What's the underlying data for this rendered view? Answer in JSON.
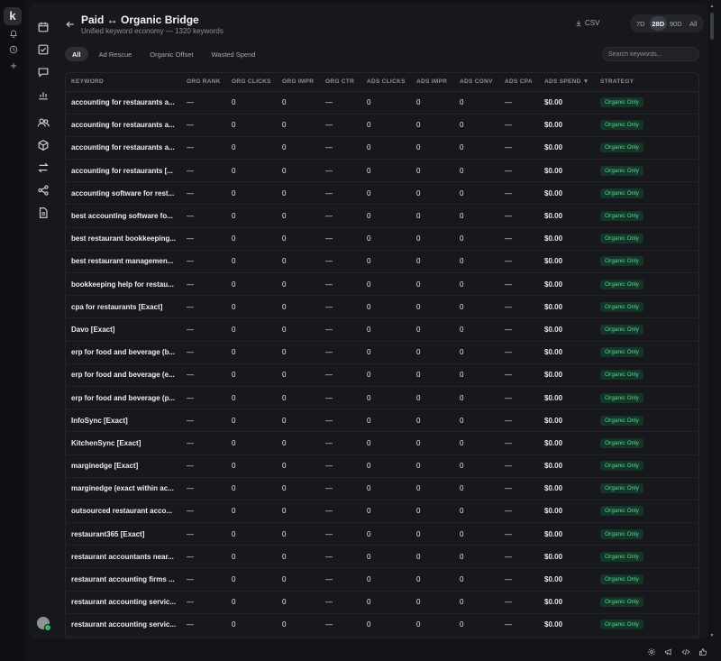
{
  "rail": {
    "logo": "k"
  },
  "header": {
    "title": "Paid ↔ Organic Bridge",
    "subtitle": "Unified keyword economy — 1320 keywords",
    "csv_label": "CSV",
    "ranges": [
      "7D",
      "28D",
      "90D",
      "All"
    ],
    "active_range": "28D"
  },
  "filters": {
    "chips": [
      "All",
      "Ad Rescue",
      "Organic Offset",
      "Wasted Spend"
    ],
    "active": "All"
  },
  "search": {
    "placeholder": "Search keywords...",
    "value": ""
  },
  "table": {
    "columns": [
      "KEYWORD",
      "ORG RANK",
      "ORG CLICKS",
      "ORG IMPR",
      "ORG CTR",
      "ADS CLICKS",
      "ADS IMPR",
      "ADS CONV",
      "ADS CPA",
      "ADS SPEND ▼",
      "STRATEGY"
    ],
    "rows": [
      [
        "accounting for restaurants a...",
        "—",
        "0",
        "0",
        "—",
        "0",
        "0",
        "0",
        "—",
        "$0.00",
        "Organic Only"
      ],
      [
        "accounting for restaurants a...",
        "—",
        "0",
        "0",
        "—",
        "0",
        "0",
        "0",
        "—",
        "$0.00",
        "Organic Only"
      ],
      [
        "accounting for restaurants a...",
        "—",
        "0",
        "0",
        "—",
        "0",
        "0",
        "0",
        "—",
        "$0.00",
        "Organic Only"
      ],
      [
        "accounting for restaurants [...",
        "—",
        "0",
        "0",
        "—",
        "0",
        "0",
        "0",
        "—",
        "$0.00",
        "Organic Only"
      ],
      [
        "accounting software for rest...",
        "—",
        "0",
        "0",
        "—",
        "0",
        "0",
        "0",
        "—",
        "$0.00",
        "Organic Only"
      ],
      [
        "best accounting software fo...",
        "—",
        "0",
        "0",
        "—",
        "0",
        "0",
        "0",
        "—",
        "$0.00",
        "Organic Only"
      ],
      [
        "best restaurant bookkeeping...",
        "—",
        "0",
        "0",
        "—",
        "0",
        "0",
        "0",
        "—",
        "$0.00",
        "Organic Only"
      ],
      [
        "best restaurant managemen...",
        "—",
        "0",
        "0",
        "—",
        "0",
        "0",
        "0",
        "—",
        "$0.00",
        "Organic Only"
      ],
      [
        "bookkeeping help for restau...",
        "—",
        "0",
        "0",
        "—",
        "0",
        "0",
        "0",
        "—",
        "$0.00",
        "Organic Only"
      ],
      [
        "cpa for restaurants [Exact]",
        "—",
        "0",
        "0",
        "—",
        "0",
        "0",
        "0",
        "—",
        "$0.00",
        "Organic Only"
      ],
      [
        "Davo [Exact]",
        "—",
        "0",
        "0",
        "—",
        "0",
        "0",
        "0",
        "—",
        "$0.00",
        "Organic Only"
      ],
      [
        "erp for food and beverage (b...",
        "—",
        "0",
        "0",
        "—",
        "0",
        "0",
        "0",
        "—",
        "$0.00",
        "Organic Only"
      ],
      [
        "erp for food and beverage (e...",
        "—",
        "0",
        "0",
        "—",
        "0",
        "0",
        "0",
        "—",
        "$0.00",
        "Organic Only"
      ],
      [
        "erp for food and beverage (p...",
        "—",
        "0",
        "0",
        "—",
        "0",
        "0",
        "0",
        "—",
        "$0.00",
        "Organic Only"
      ],
      [
        "InfoSync [Exact]",
        "—",
        "0",
        "0",
        "—",
        "0",
        "0",
        "0",
        "—",
        "$0.00",
        "Organic Only"
      ],
      [
        "KitchenSync [Exact]",
        "—",
        "0",
        "0",
        "—",
        "0",
        "0",
        "0",
        "—",
        "$0.00",
        "Organic Only"
      ],
      [
        "marginedge [Exact]",
        "—",
        "0",
        "0",
        "—",
        "0",
        "0",
        "0",
        "—",
        "$0.00",
        "Organic Only"
      ],
      [
        "marginedge (exact within ac...",
        "—",
        "0",
        "0",
        "—",
        "0",
        "0",
        "0",
        "—",
        "$0.00",
        "Organic Only"
      ],
      [
        "outsourced restaurant acco...",
        "—",
        "0",
        "0",
        "—",
        "0",
        "0",
        "0",
        "—",
        "$0.00",
        "Organic Only"
      ],
      [
        "restaurant365 [Exact]",
        "—",
        "0",
        "0",
        "—",
        "0",
        "0",
        "0",
        "—",
        "$0.00",
        "Organic Only"
      ],
      [
        "restaurant accountants near...",
        "—",
        "0",
        "0",
        "—",
        "0",
        "0",
        "0",
        "—",
        "$0.00",
        "Organic Only"
      ],
      [
        "restaurant accounting firms ...",
        "—",
        "0",
        "0",
        "—",
        "0",
        "0",
        "0",
        "—",
        "$0.00",
        "Organic Only"
      ],
      [
        "restaurant accounting servic...",
        "—",
        "0",
        "0",
        "—",
        "0",
        "0",
        "0",
        "—",
        "$0.00",
        "Organic Only"
      ],
      [
        "restaurant accounting servic...",
        "—",
        "0",
        "0",
        "—",
        "0",
        "0",
        "0",
        "—",
        "$0.00",
        "Organic Only"
      ]
    ]
  },
  "colors": {
    "background": "#121316",
    "panel": "#17181c",
    "accent_green": "#4ade80",
    "pill_bg": "#16352a"
  },
  "icons": {
    "rail": [
      "bell-icon",
      "history-icon",
      "plus-icon"
    ],
    "sidebar": [
      "calendar-icon",
      "checkbox-icon",
      "chat-icon",
      "bar-chart-icon",
      "users-icon",
      "box-icon",
      "swap-icon",
      "share-icon",
      "document-icon"
    ],
    "bottom": [
      "settings-icon",
      "megaphone-icon",
      "code-icon",
      "thumbs-up-icon"
    ]
  }
}
